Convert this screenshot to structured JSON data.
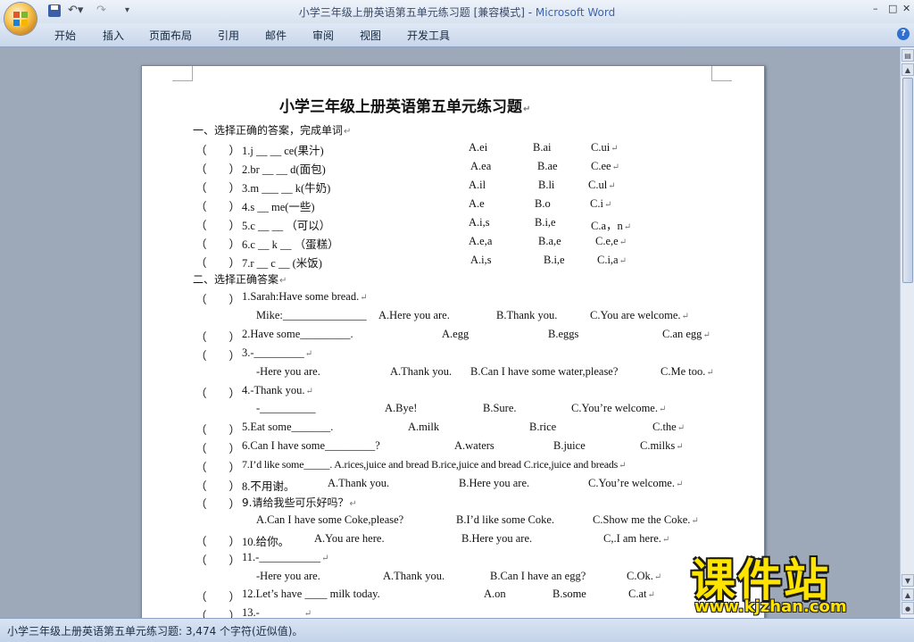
{
  "window": {
    "title": "小学三年级上册英语第五单元练习题 [兼容模式] - ",
    "app_name": "Microsoft Word",
    "controls": {
      "minimize": "–",
      "maximize": "□",
      "close": "✕"
    }
  },
  "quick_access": {
    "undo": "↶",
    "undo_arrow": "▾",
    "redo": "↷",
    "more": "▾"
  },
  "ribbon": {
    "tabs": [
      "开始",
      "插入",
      "页面布局",
      "引用",
      "邮件",
      "审阅",
      "视图",
      "开发工具"
    ],
    "help": "?"
  },
  "document": {
    "title": "小学三年级上册英语第五单元练习题",
    "section1": "一、选择正确的答案，完成单词",
    "s1_items": [
      {
        "paren": "（　　）",
        "stem": "1.j __  __  ce(果汁)",
        "a": "A.ei",
        "b": "B.ai",
        "c": "C.ui"
      },
      {
        "paren": "（　　）",
        "stem": "2.br  __  __  d(面包)",
        "a": "A.ea",
        "b": "B.ae",
        "c": "C.ee"
      },
      {
        "paren": "（　　）",
        "stem": "3.m  ___  __  k(牛奶)",
        "a": "A.il",
        "b": "B.li",
        "c": "C.ul"
      },
      {
        "paren": "（　　）",
        "stem": "4.s  __  me(一些)",
        "a": "A.e",
        "b": "B.o",
        "c": "C.i"
      },
      {
        "paren": "（　　）",
        "stem": "5.c  __  __  （可以）",
        "a": "A.i,s",
        "b": "B.i,e",
        "c": "C.a，n"
      },
      {
        "paren": "（　　）",
        "stem": "6.c  __  k  __  （蛋糕）",
        "a": "A.e,a",
        "b": "B.a,e",
        "c": "C.e,e"
      },
      {
        "paren": "（　　）",
        "stem": "7.r  __  c  __  (米饭)",
        "a": "A.i,s",
        "b": "B.i,e",
        "c": "C.i,a"
      }
    ],
    "section2": "二、选择正确答案",
    "s2_lines": {
      "q1": "1.Sarah:Have some bread.",
      "q1_sub": "Mike:_______________",
      "q1_a": "A.Here you are.",
      "q1_b": "B.Thank you.",
      "q1_c": "C.You are welcome.",
      "q2": "2.Have some_________.",
      "q2_a": "A.egg",
      "q2_b": "B.eggs",
      "q2_c": "C.an egg",
      "q3": "3.-_________",
      "q3_sub": "-Here you are.",
      "q3_a": "A.Thank you.",
      "q3_b": "B.Can I have some water,please?",
      "q3_c": "C.Me too.",
      "q4": "4.-Thank you.",
      "q4_sub": "-__________",
      "q4_a": "A.Bye!",
      "q4_b": "B.Sure.",
      "q4_c": "C.You’re welcome.",
      "q5": "5.Eat some_______.",
      "q5_a": "A.milk",
      "q5_b": "B.rice",
      "q5_c": "C.the",
      "q6": "6.Can I have some_________?",
      "q6_a": "A.waters",
      "q6_b": "B.juice",
      "q6_c": "C.milks",
      "q7": "7.I’d like some_____. A.rices,juice and bread   B.rice,juice and bread C.rice,juice and breads",
      "q8": "8.不用谢。",
      "q8_a": "A.Thank you.",
      "q8_b": "B.Here you are.",
      "q8_c": "C.You’re welcome.",
      "q9": "9.请给我些可乐好吗？",
      "q9_a": "A.Can I have some Coke,please?",
      "q9_b": "B.I’d like some Coke.",
      "q9_c": "C.Show me the Coke.",
      "q10": "10.给你。",
      "q10_a": "A.You are here.",
      "q10_b": "B.Here you are.",
      "q10_c": "C,.I am here.",
      "q11": "11.-___________",
      "q11_sub": "-Here you are.",
      "q11_a": "A.Thank you.",
      "q11_b": "B.Can I have an egg?",
      "q11_c": "C.Ok.",
      "q12": "12.Let’s have  ____  milk today.",
      "q12_a": "A.on",
      "q12_b": "B.some",
      "q12_c": "C.at",
      "q13": "13.-",
      "paren": "（　　）"
    },
    "para_mark": "↵"
  },
  "statusbar": {
    "text": "小学三年级上册英语第五单元练习题: 3,474 个字符(近似值)。"
  },
  "watermark": {
    "title": "课件站",
    "url": "www.kjzhan.com"
  }
}
